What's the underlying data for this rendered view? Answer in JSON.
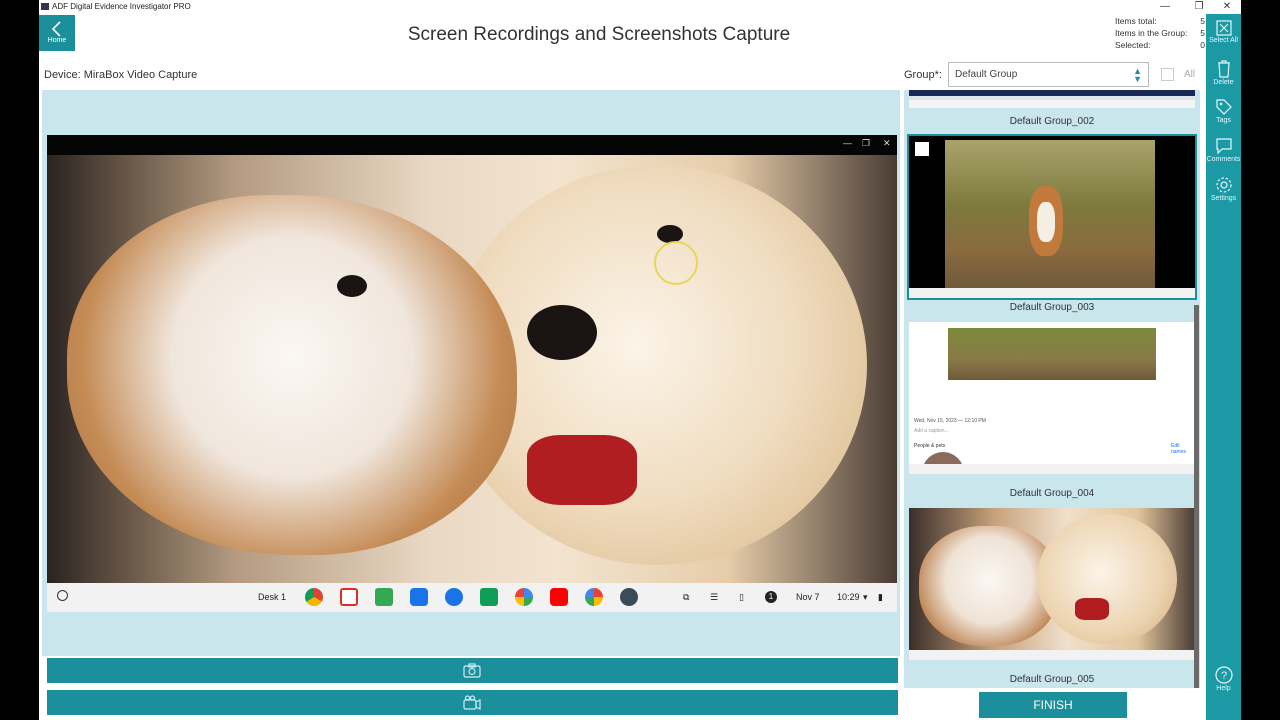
{
  "window": {
    "title": "ADF Digital Evidence Investigator PRO",
    "controls": {
      "minimize": "—",
      "maximize": "❐",
      "close": "✕"
    }
  },
  "header": {
    "home_label": "Home",
    "page_title": "Screen Recordings and Screenshots Capture",
    "counts": [
      {
        "label": "Items total:",
        "value": "5"
      },
      {
        "label": "Items in the Group:",
        "value": "5"
      },
      {
        "label": "Selected:",
        "value": "0"
      }
    ]
  },
  "device": {
    "label": "Device: MiraBox Video Capture"
  },
  "group": {
    "label": "Group*:",
    "selected": "Default Group",
    "all_label": "All"
  },
  "video": {
    "taskbar": {
      "desk": "Desk 1",
      "date": "Nov 7",
      "time": "10:29"
    }
  },
  "thumbnails": [
    {
      "caption": "Default Group_002",
      "selected": false
    },
    {
      "caption": "Default Group_003",
      "selected": true
    },
    {
      "caption": "Default Group_004",
      "selected": false
    },
    {
      "caption": "Default Group_005",
      "selected": false
    }
  ],
  "thumb_004_detail": {
    "date": "Wed, Nov 15, 2023 — 12:10 PM",
    "caption_hint": "Add a caption...",
    "people": "People & pets",
    "edit": "Edit names"
  },
  "finish_label": "FINISH",
  "right_rail": [
    {
      "label": "Select All",
      "icon": "select-all-icon"
    },
    {
      "label": "Delete",
      "icon": "trash-icon"
    },
    {
      "label": "Tags",
      "icon": "tag-icon"
    },
    {
      "label": "Comments",
      "icon": "comment-icon"
    },
    {
      "label": "Settings",
      "icon": "gear-icon"
    },
    {
      "label": "Help",
      "icon": "help-icon"
    }
  ],
  "colors": {
    "accent": "#1b8f9b",
    "rail": "#1b9aa6",
    "panel": "#c8e6ec"
  }
}
